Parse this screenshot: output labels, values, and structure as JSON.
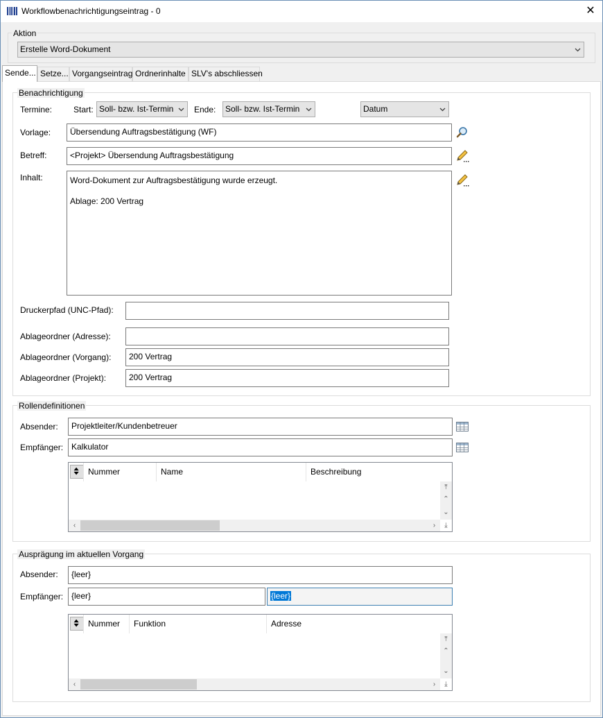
{
  "window": {
    "title": "Workflowbenachrichtigungseintrag - 0",
    "close_glyph": "✕",
    "app_icon": "barcode-icon"
  },
  "aktion": {
    "group_label": "Aktion",
    "selected": "Erstelle Word-Dokument"
  },
  "tabs": [
    {
      "label": "Sende...",
      "active": true
    },
    {
      "label": "Setze..."
    },
    {
      "label": "Vorgangseintrag"
    },
    {
      "label": "Ordnerinhalte"
    },
    {
      "label": "SLV's abschliessen"
    }
  ],
  "benachrichtigung": {
    "group_label": "Benachrichtigung",
    "termine_label": "Termine:",
    "start_label": "Start:",
    "start_value": "Soll- bzw. Ist-Termin",
    "ende_label": "Ende:",
    "ende_value": "Soll- bzw. Ist-Termin",
    "datum_value": "Datum",
    "vorlage_label": "Vorlage:",
    "vorlage_value": "Übersendung Auftragsbestätigung (WF)",
    "betreff_label": "Betreff:",
    "betreff_value": "<Projekt> Übersendung Auftragsbestätigung",
    "inhalt_label": "Inhalt:",
    "inhalt_line1": "Word-Dokument zur Auftragsbestätigung wurde erzeugt.",
    "inhalt_line2": "Ablage: 200 Vertrag",
    "druckerpfad_label": "Druckerpfad (UNC-Pfad):",
    "druckerpfad_value": "",
    "ablage_adresse_label": "Ablageordner (Adresse):",
    "ablage_adresse_value": "",
    "ablage_vorgang_label": "Ablageordner (Vorgang):",
    "ablage_vorgang_value": "200 Vertrag",
    "ablage_projekt_label": "Ablageordner (Projekt):",
    "ablage_projekt_value": "200 Vertrag"
  },
  "rollen": {
    "group_label": "Rollendefinitionen",
    "absender_label": "Absender:",
    "absender_value": "Projektleiter/Kundenbetreuer",
    "empfaenger_label": "Empfänger:",
    "empfaenger_value": "Kalkulator",
    "columns": [
      "Nummer",
      "Name",
      "Beschreibung"
    ]
  },
  "auspraegung": {
    "group_label": "Ausprägung im aktuellen Vorgang",
    "absender_label": "Absender:",
    "absender_value": "{leer}",
    "empfaenger_label": "Empfänger:",
    "empfaenger_value": "{leer}",
    "empfaenger_value2": "{leer}",
    "columns": [
      "Nummer",
      "Funktion",
      "Adresse"
    ]
  },
  "colors": {
    "selection": "#0078d7",
    "focus_border": "#3c7fb1"
  }
}
